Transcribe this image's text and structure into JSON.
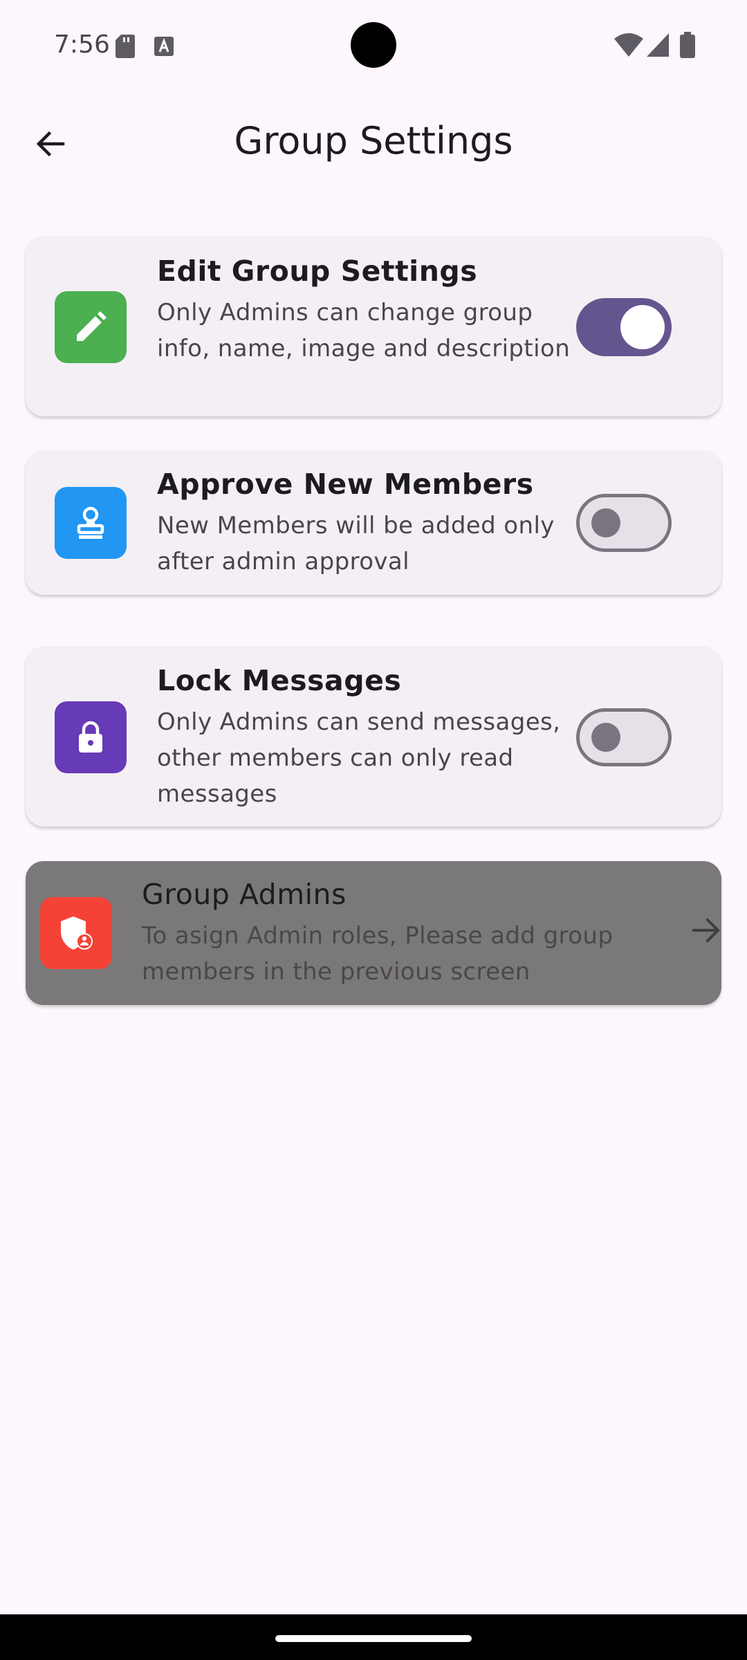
{
  "status_bar": {
    "time": "7:56",
    "icons": [
      "sd-card-icon",
      "keyboard-a-icon",
      "wifi-icon",
      "signal-icon",
      "battery-icon"
    ]
  },
  "app_bar": {
    "title": "Group Settings",
    "back_icon": "arrow-back-icon"
  },
  "settings": [
    {
      "title": "Edit Group Settings",
      "description": "Only Admins can change group info, name, image and description",
      "icon": "pencil-icon",
      "icon_color": "#4caf50",
      "enabled": true
    },
    {
      "title": "Approve New Members",
      "description": "New Members will be added only after admin approval",
      "icon": "stamp-icon",
      "icon_color": "#2196f3",
      "enabled": false
    },
    {
      "title": "Lock Messages",
      "description": "Only Admins can send messages, other members can only read messages",
      "icon": "lock-icon",
      "icon_color": "#673ab7",
      "enabled": false
    }
  ],
  "group_admins": {
    "title": "Group Admins",
    "description": "To asign Admin roles, Please add group members in the previous screen",
    "icon": "admin-shield-icon",
    "icon_color": "#f44336",
    "trailing_icon": "arrow-forward-icon",
    "disabled": true
  },
  "colors": {
    "background": "#fdf7fd",
    "card": "#f4eff4",
    "toggle_on": "#65558f",
    "toggle_off_border": "#79747e",
    "disabled_card": "#7a7879"
  }
}
